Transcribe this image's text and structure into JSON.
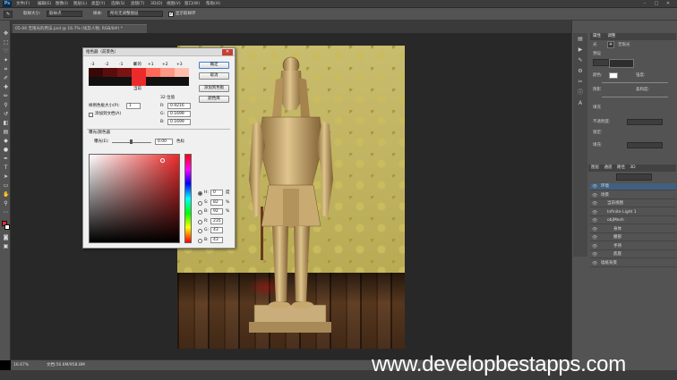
{
  "app": {
    "logo": "Ps"
  },
  "menu": [
    "文件(F)",
    "编辑(E)",
    "图像(I)",
    "图层(L)",
    "类型(Y)",
    "选择(S)",
    "滤镜(T)",
    "3D(D)",
    "视图(V)",
    "窗口(W)",
    "帮助(H)"
  ],
  "window_controls": [
    "–",
    "□",
    "✕"
  ],
  "options": {
    "sample_size_label": "取样大小:",
    "sample_size_value": "取样点",
    "sample_label": "样本:",
    "sample_value": "所有无调整图层",
    "show_ring_checked": true,
    "show_ring_label": "显示取样环"
  },
  "document": {
    "tab_title": "05-06 无限光的用法.psd @ 16.7% (埃及人物, RGB/8#) *"
  },
  "status": {
    "zoom": "16.67%",
    "doc_size": "文档:56.6M/958.8M"
  },
  "dialog": {
    "title": "拾色器（前景色）",
    "close": "✕",
    "new_label": "新的",
    "current_label": "当前",
    "swatch_numbers": [
      "-3",
      "-2",
      "-1",
      "0",
      "+1",
      "+2",
      "+3"
    ],
    "btn_ok": "确定",
    "btn_cancel": "取消",
    "btn_add_swatch": "添加到色板",
    "btn_libraries": "颜色库",
    "bit_label": "32 位值",
    "r_label": "R:",
    "r_float": "0.9216",
    "g_label": "G:",
    "g_float": "0.1699",
    "b_label": "B:",
    "b_float": "0.1699",
    "sample_radius_label": "样例色板大小(P):",
    "sample_radius_value": "1",
    "add_to_doc_label": "添加到文档(A)",
    "hdr_title": "曝光/颜色器",
    "exposure_label": "曝光(E):",
    "exposure_value": "0.00",
    "exposure_unit": "色标",
    "h_label": "H:",
    "h_value": "0",
    "h_unit": "度",
    "s_label": "S:",
    "s_value": "82",
    "s_unit": "%",
    "b2_label": "B:",
    "b2_value": "92",
    "b2_unit": "%",
    "r_int_label": "R:",
    "r_int": "235",
    "g_int_label": "G:",
    "g_int": "43",
    "b_int_label": "B:",
    "b_int": "43",
    "colors": {
      "base": "#eb2b2b",
      "swatches": [
        "#3a0707",
        "#5a0d0d",
        "#7a1313",
        "#eb2b2b",
        "#ff6a5a",
        "#ff9686",
        "#ffbdb0"
      ]
    }
  },
  "right_panels": {
    "properties_tab": "属性",
    "adjust_tab": "调整",
    "properties_label": "光",
    "infinity_light": "无限光",
    "preset_label": "预设",
    "color_label": "颜色:",
    "intensity_label": "强度:",
    "shadow_label": "阴影",
    "softness_label": "柔和度:",
    "section_fill": "填充",
    "fill_label": "不透明度:",
    "lock_label": "锁定:",
    "fill2_label": "填充:",
    "layers_tabs": [
      "图层",
      "通道",
      "路径",
      "3D"
    ],
    "layers": [
      {
        "name": "环境",
        "indent": 0
      },
      {
        "name": "场景",
        "indent": 0
      },
      {
        "name": "当前视图",
        "indent": 1
      },
      {
        "name": "Infinite Light 1",
        "indent": 1
      },
      {
        "name": "objMesh",
        "indent": 1
      },
      {
        "name": "身体",
        "indent": 2
      },
      {
        "name": "腰部",
        "indent": 2
      },
      {
        "name": "手持",
        "indent": 2
      },
      {
        "name": "底座",
        "indent": 2
      },
      {
        "name": "墙纸背景",
        "indent": 0
      }
    ]
  },
  "watermark": "www.developbestapps.com"
}
